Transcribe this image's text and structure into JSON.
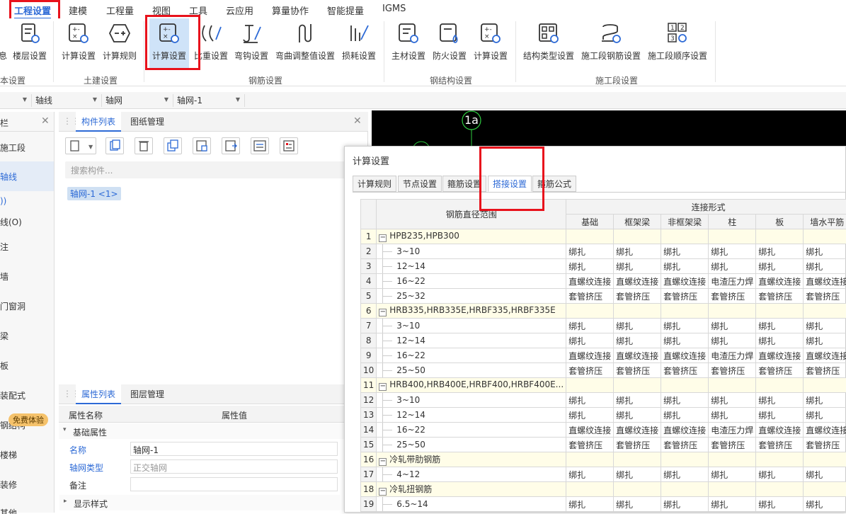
{
  "menu": [
    "工程设置",
    "建模",
    "工程量",
    "视图",
    "工具",
    "云应用",
    "算量协作",
    "智能提量",
    "IGMS"
  ],
  "ribbon": {
    "buttons": [
      "息",
      "楼层设置",
      "计算设置",
      "计算规则",
      "计算设置",
      "比重设置",
      "弯钩设置",
      "弯曲调整值设置",
      "损耗设置",
      "主材设置",
      "防火设置",
      "计算设置",
      "结构类型设置",
      "施工段钢筋设置",
      "施工段顺序设置"
    ],
    "groups": [
      "本设置",
      "土建设置",
      "钢筋设置",
      "钢结构设置",
      "施工段设置"
    ]
  },
  "toolbar2": {
    "axis": "轴线",
    "grid": "轴网",
    "item": "轴网-1"
  },
  "left_panel": {
    "title": "栏",
    "items": [
      "施工段",
      "轴线",
      "))",
      "线(O)",
      "注",
      "墙",
      "门窗洞",
      "梁",
      "板",
      "装配式",
      "钢结构",
      "楼梯",
      "装修",
      "其他"
    ],
    "trial_badge": "免费体验"
  },
  "component_panel": {
    "tabs": [
      "构件列表",
      "图纸管理"
    ],
    "search_placeholder": "搜索构件...",
    "item": "轴网-1 <1>"
  },
  "property_panel": {
    "tabs": [
      "属性列表",
      "图层管理"
    ],
    "header": [
      "属性名称",
      "属性值"
    ],
    "section": "基础属性",
    "rows": [
      {
        "name": "名称",
        "value": "轴网-1"
      },
      {
        "name": "轴网类型",
        "value": "正交轴网"
      },
      {
        "name": "备注",
        "value": ""
      }
    ],
    "section2": "显示样式"
  },
  "canvas": {
    "label": "1a"
  },
  "dialog": {
    "title": "计算设置",
    "tabs": [
      "计算规则",
      "节点设置",
      "箍筋设置",
      "搭接设置",
      "箍筋公式"
    ],
    "header_main": "钢筋直径范围",
    "header_group": "连接形式",
    "columns": [
      "基础",
      "框架梁",
      "非框架梁",
      "柱",
      "板",
      "墙水平筋"
    ],
    "rows": [
      {
        "n": "1",
        "group": true,
        "label": "HPB235,HPB300",
        "cells": []
      },
      {
        "n": "2",
        "label": "3~10",
        "cells": [
          "绑扎",
          "绑扎",
          "绑扎",
          "绑扎",
          "绑扎",
          "绑扎"
        ]
      },
      {
        "n": "3",
        "label": "12~14",
        "cells": [
          "绑扎",
          "绑扎",
          "绑扎",
          "绑扎",
          "绑扎",
          "绑扎"
        ]
      },
      {
        "n": "4",
        "label": "16~22",
        "cells": [
          "直螺纹连接",
          "直螺纹连接",
          "直螺纹连接",
          "电渣压力焊",
          "直螺纹连接",
          "直螺纹连接"
        ]
      },
      {
        "n": "5",
        "label": "25~32",
        "cells": [
          "套管挤压",
          "套管挤压",
          "套管挤压",
          "套管挤压",
          "套管挤压",
          "套管挤压"
        ]
      },
      {
        "n": "6",
        "group": true,
        "label": "HRB335,HRB335E,HRBF335,HRBF335E",
        "cells": []
      },
      {
        "n": "7",
        "label": "3~10",
        "cells": [
          "绑扎",
          "绑扎",
          "绑扎",
          "绑扎",
          "绑扎",
          "绑扎"
        ]
      },
      {
        "n": "8",
        "label": "12~14",
        "cells": [
          "绑扎",
          "绑扎",
          "绑扎",
          "绑扎",
          "绑扎",
          "绑扎"
        ]
      },
      {
        "n": "9",
        "label": "16~22",
        "cells": [
          "直螺纹连接",
          "直螺纹连接",
          "直螺纹连接",
          "电渣压力焊",
          "直螺纹连接",
          "直螺纹连接"
        ]
      },
      {
        "n": "10",
        "label": "25~50",
        "cells": [
          "套管挤压",
          "套管挤压",
          "套管挤压",
          "套管挤压",
          "套管挤压",
          "套管挤压"
        ]
      },
      {
        "n": "11",
        "group": true,
        "label": "HRB400,HRB400E,HRBF400,HRBF400E...",
        "cells": []
      },
      {
        "n": "12",
        "label": "3~10",
        "cells": [
          "绑扎",
          "绑扎",
          "绑扎",
          "绑扎",
          "绑扎",
          "绑扎"
        ]
      },
      {
        "n": "13",
        "label": "12~14",
        "cells": [
          "绑扎",
          "绑扎",
          "绑扎",
          "绑扎",
          "绑扎",
          "绑扎"
        ]
      },
      {
        "n": "14",
        "label": "16~22",
        "cells": [
          "直螺纹连接",
          "直螺纹连接",
          "直螺纹连接",
          "电渣压力焊",
          "直螺纹连接",
          "直螺纹连接"
        ]
      },
      {
        "n": "15",
        "label": "25~50",
        "cells": [
          "套管挤压",
          "套管挤压",
          "套管挤压",
          "套管挤压",
          "套管挤压",
          "套管挤压"
        ]
      },
      {
        "n": "16",
        "group": true,
        "label": "冷轧带肋钢筋",
        "cells": []
      },
      {
        "n": "17",
        "label": "4~12",
        "cells": [
          "绑扎",
          "绑扎",
          "绑扎",
          "绑扎",
          "绑扎",
          "绑扎"
        ]
      },
      {
        "n": "18",
        "group": true,
        "label": "冷轧扭钢筋",
        "cells": []
      },
      {
        "n": "19",
        "label": "6.5~14",
        "cells": [
          "绑扎",
          "绑扎",
          "绑扎",
          "绑扎",
          "绑扎",
          "绑扎"
        ]
      }
    ]
  },
  "colors": {
    "accent": "#2d6ad6",
    "highlight_box": "#e8121c",
    "selected_ribbon": "#cfe3f8",
    "group_row": "#fffde8"
  }
}
